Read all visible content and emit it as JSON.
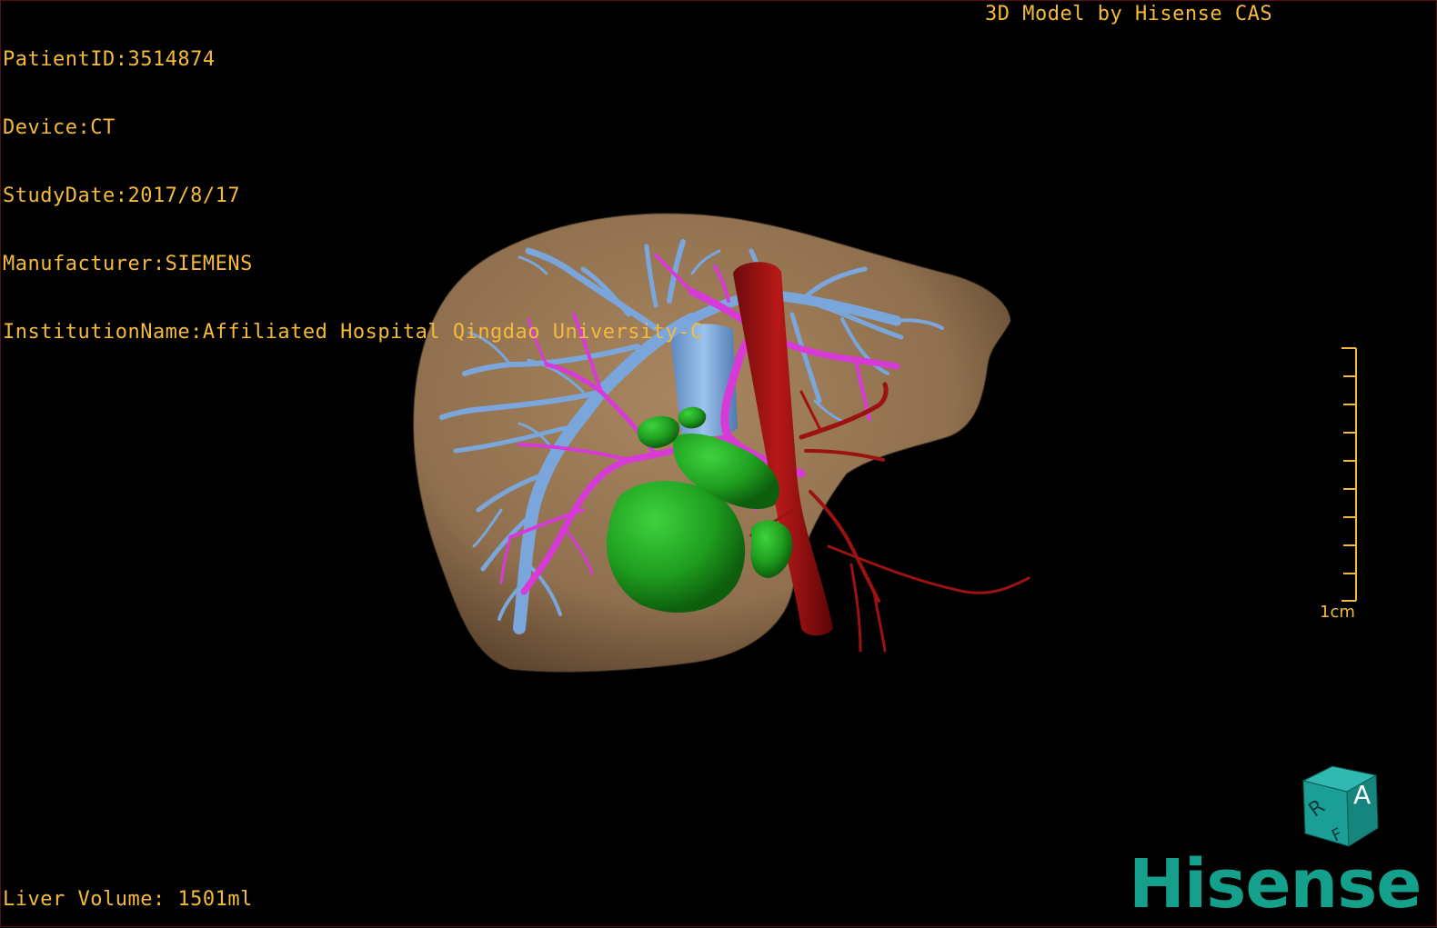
{
  "overlay": {
    "patient_id": "PatientID:3514874",
    "device": "Device:CT",
    "study_date": "StudyDate:2017/8/17",
    "manufacturer": "Manufacturer:SIEMENS",
    "institution": "InstitutionName:Affiliated Hospital Qingdao University-C",
    "credit": "3D Model by Hisense CAS",
    "liver_volume": "Liver Volume: 1501ml"
  },
  "scale": {
    "label": "1cm"
  },
  "orientation_cube": {
    "face_top": "A",
    "face_left": "R",
    "face_bottom": "F"
  },
  "brand": {
    "logo_text": "Hisense"
  },
  "colors": {
    "overlay_text": "#f4ba3c",
    "liver": "#9c7a56",
    "portal_vein": "#7aa6dc",
    "hepatic_artery_tree": "#d83ad8",
    "aorta": "#a01414",
    "gallbladder_cyst": "#1e9e1e",
    "logo": "#15a08c"
  }
}
